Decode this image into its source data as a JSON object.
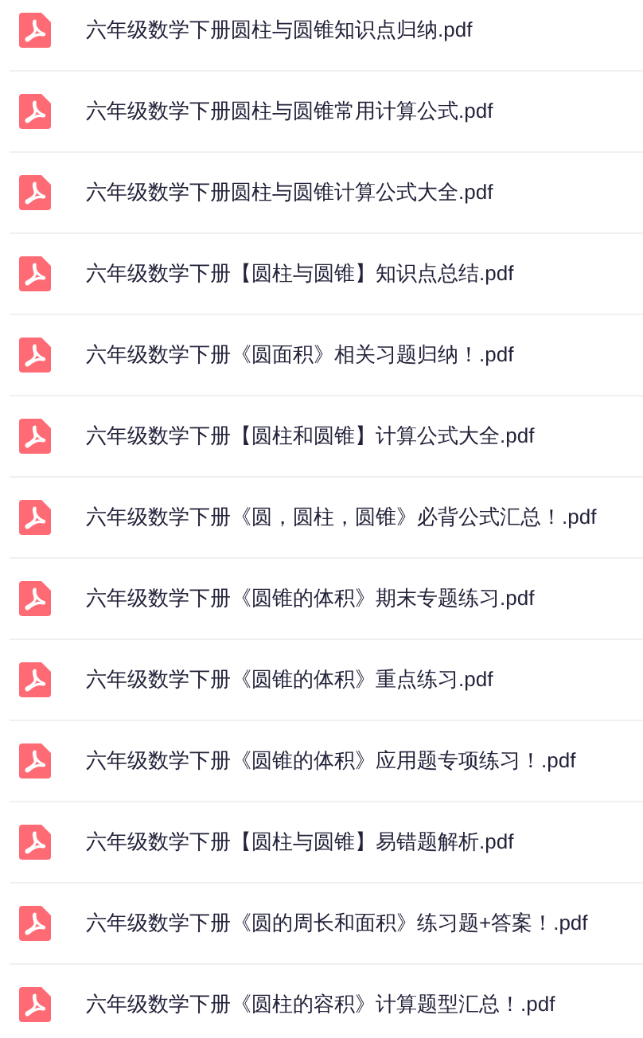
{
  "files": [
    {
      "name": "六年级数学下册圆柱与圆锥知识点归纳.pdf"
    },
    {
      "name": "六年级数学下册圆柱与圆锥常用计算公式.pdf"
    },
    {
      "name": "六年级数学下册圆柱与圆锥计算公式大全.pdf"
    },
    {
      "name": "六年级数学下册【圆柱与圆锥】知识点总结.pdf"
    },
    {
      "name": "六年级数学下册《圆面积》相关习题归纳！.pdf"
    },
    {
      "name": "六年级数学下册【圆柱和圆锥】计算公式大全.pdf"
    },
    {
      "name": "六年级数学下册《圆，圆柱，圆锥》必背公式汇总！.pdf"
    },
    {
      "name": "六年级数学下册《圆锥的体积》期末专题练习.pdf"
    },
    {
      "name": "六年级数学下册《圆锥的体积》重点练习.pdf"
    },
    {
      "name": "六年级数学下册《圆锥的体积》应用题专项练习！.pdf"
    },
    {
      "name": "六年级数学下册【圆柱与圆锥】易错题解析.pdf"
    },
    {
      "name": "六年级数学下册《圆的周长和面积》练习题+答案！.pdf"
    },
    {
      "name": "六年级数学下册《圆柱的容积》计算题型汇总！.pdf"
    }
  ]
}
